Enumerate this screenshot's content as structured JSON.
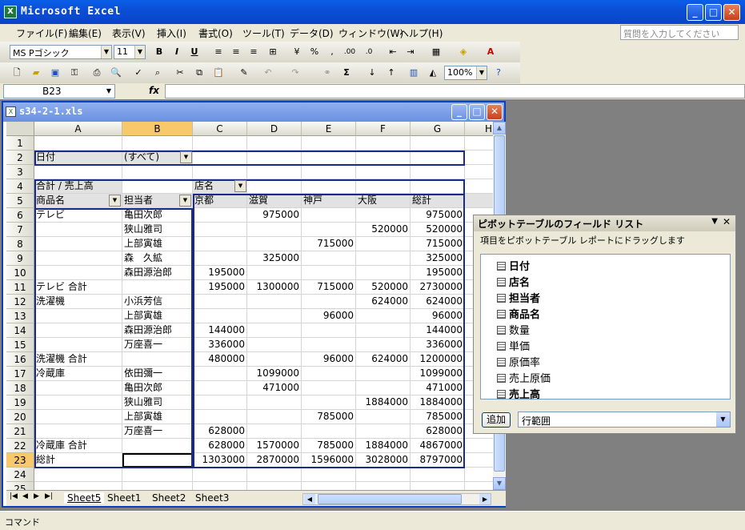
{
  "app": {
    "title": "Microsoft Excel"
  },
  "menu": [
    "ファイル(F)",
    "編集(E)",
    "表示(V)",
    "挿入(I)",
    "書式(O)",
    "ツール(T)",
    "データ(D)",
    "ウィンドウ(W)",
    "ヘルプ(H)"
  ],
  "ask_placeholder": "質問を入力してください",
  "font": {
    "name": "MS Pゴシック",
    "size": "11"
  },
  "zoom": "100%",
  "formula": {
    "name_box": "B23",
    "fx": "fx",
    "value": ""
  },
  "workbook": {
    "title": "s34-2-1.xls"
  },
  "columns": [
    "A",
    "B",
    "C",
    "D",
    "E",
    "F",
    "G",
    "H"
  ],
  "rows": [
    [
      "",
      "",
      "",
      "",
      "",
      "",
      ""
    ],
    [
      "日付",
      "(すべて)",
      "",
      "",
      "",
      "",
      ""
    ],
    [
      "",
      "",
      "",
      "",
      "",
      "",
      ""
    ],
    [
      "合計 / 売上高",
      "",
      "店名",
      "",
      "",
      "",
      ""
    ],
    [
      "商品名",
      "担当者",
      "京都",
      "滋賀",
      "神戸",
      "大阪",
      "総計"
    ],
    [
      "テレビ",
      "亀田次郎",
      "",
      "975000",
      "",
      "",
      "975000"
    ],
    [
      "",
      "狭山雅司",
      "",
      "",
      "",
      "520000",
      "520000"
    ],
    [
      "",
      "上部寅雄",
      "",
      "",
      "715000",
      "",
      "715000"
    ],
    [
      "",
      "森　久絋",
      "",
      "325000",
      "",
      "",
      "325000"
    ],
    [
      "",
      "森田源治郎",
      "195000",
      "",
      "",
      "",
      "195000"
    ],
    [
      "テレビ 合計",
      "",
      "195000",
      "1300000",
      "715000",
      "520000",
      "2730000"
    ],
    [
      "洗濯機",
      "小浜芳信",
      "",
      "",
      "",
      "624000",
      "624000"
    ],
    [
      "",
      "上部寅雄",
      "",
      "",
      "96000",
      "",
      "96000"
    ],
    [
      "",
      "森田源治郎",
      "144000",
      "",
      "",
      "",
      "144000"
    ],
    [
      "",
      "万座喜一",
      "336000",
      "",
      "",
      "",
      "336000"
    ],
    [
      "洗濯機 合計",
      "",
      "480000",
      "",
      "96000",
      "624000",
      "1200000"
    ],
    [
      "冷蔵庫",
      "依田彌一",
      "",
      "1099000",
      "",
      "",
      "1099000"
    ],
    [
      "",
      "亀田次郎",
      "",
      "471000",
      "",
      "",
      "471000"
    ],
    [
      "",
      "狭山雅司",
      "",
      "",
      "",
      "1884000",
      "1884000"
    ],
    [
      "",
      "上部寅雄",
      "",
      "",
      "785000",
      "",
      "785000"
    ],
    [
      "",
      "万座喜一",
      "628000",
      "",
      "",
      "",
      "628000"
    ],
    [
      "冷蔵庫 合計",
      "",
      "628000",
      "1570000",
      "785000",
      "1884000",
      "4867000"
    ],
    [
      "総計",
      "",
      "1303000",
      "2870000",
      "1596000",
      "3028000",
      "8797000"
    ],
    [
      "",
      "",
      "",
      "",
      "",
      "",
      ""
    ],
    [
      "",
      "",
      "",
      "",
      "",
      "",
      ""
    ]
  ],
  "sheets": [
    "Sheet5",
    "Sheet1",
    "Sheet2",
    "Sheet3"
  ],
  "pivot_field_list": {
    "title": "ピボットテーブルのフィールド リスト",
    "instruction": "項目をピボットテーブル レポートにドラッグします",
    "fields": [
      {
        "label": "日付",
        "bold": true
      },
      {
        "label": "店名",
        "bold": true
      },
      {
        "label": "担当者",
        "bold": true
      },
      {
        "label": "商品名",
        "bold": true
      },
      {
        "label": "数量",
        "bold": false
      },
      {
        "label": "単価",
        "bold": false
      },
      {
        "label": "原価率",
        "bold": false
      },
      {
        "label": "売上原価",
        "bold": false
      },
      {
        "label": "売上高",
        "bold": true
      }
    ],
    "add_button": "追加",
    "area_select": "行範囲"
  },
  "status": {
    "text": "コマンド"
  }
}
